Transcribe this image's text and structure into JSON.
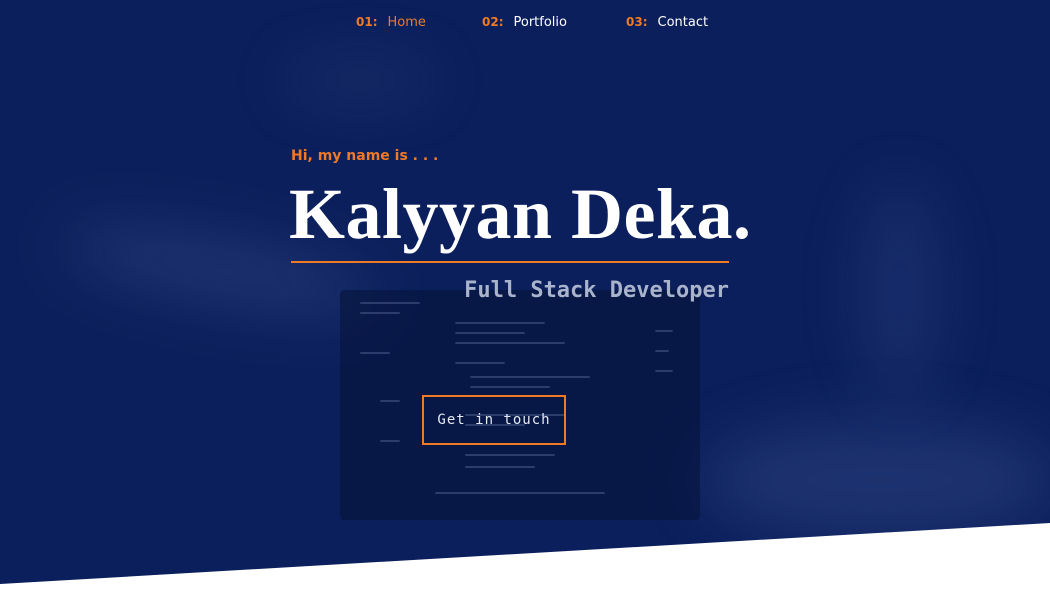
{
  "nav": {
    "items": [
      {
        "number": "01:",
        "label": "Home",
        "active": true
      },
      {
        "number": "02:",
        "label": "Portfolio",
        "active": false
      },
      {
        "number": "03:",
        "label": "Contact",
        "active": false
      }
    ]
  },
  "hero": {
    "greeting": "Hi, my name is . . .",
    "name": "Kalyyan Deka.",
    "role": "Full Stack Developer",
    "cta_label": "Get in touch"
  },
  "colors": {
    "background": "#0b1f5c",
    "accent": "#f07a24",
    "text": "#ffffff",
    "muted": "#a9b3cc"
  }
}
